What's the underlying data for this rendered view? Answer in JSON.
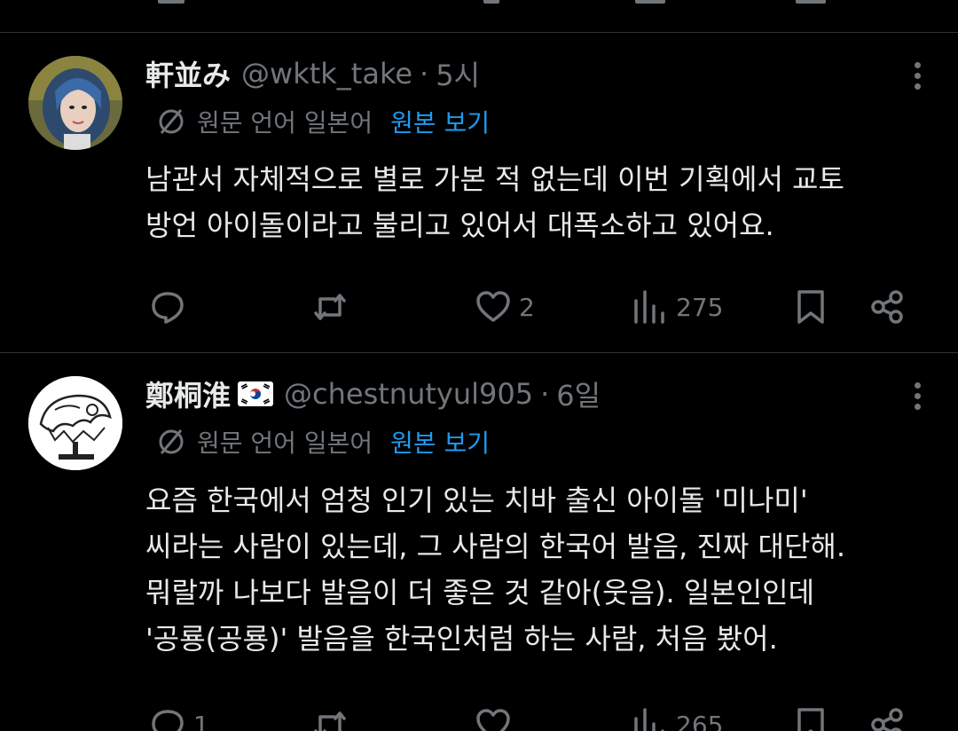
{
  "posts": [
    {
      "display_name": "軒並み",
      "handle": "@wktk_take",
      "separator": "·",
      "time": "5시",
      "has_flag": false,
      "translate": {
        "label": "원문 언어 일본어",
        "link": "원본 보기"
      },
      "lines": [
        "남관서 자체적으로 별로 가본 적 없는데 이번 기획에서 교토",
        "방언 아이돌이라고 불리고 있어서 대폭소하고 있어요."
      ],
      "stats": {
        "replies": "",
        "reposts": "",
        "likes": "2",
        "views": "275"
      }
    },
    {
      "display_name": "鄭桐淮",
      "handle": "@chestnutyul905",
      "separator": "·",
      "time": "6일",
      "has_flag": true,
      "translate": {
        "label": "원문 언어 일본어",
        "link": "원본 보기"
      },
      "lines": [
        "요즘 한국에서 엄청 인기 있는 치바 출신 아이돌 '미나미'",
        "씨라는 사람이 있는데, 그 사람의 한국어 발음, 진짜 대단해.",
        "뭐랄까 나보다 발음이 더 좋은 것 같아(웃음). 일본인인데",
        "'공룡(공룡)' 발음을 한국인처럼 하는 사람, 처음 봤어."
      ],
      "stats": {
        "replies": "1",
        "reposts": "",
        "likes": "",
        "views": "265"
      }
    }
  ],
  "colors": {
    "background": "#000000",
    "text": "#e7e9ea",
    "muted": "#71767b",
    "link": "#1d9bf0",
    "divider": "#2f3336"
  },
  "icons": {
    "reply": "reply-icon",
    "repost": "repost-icon",
    "like": "heart-icon",
    "views": "views-icon",
    "bookmark": "bookmark-icon",
    "share": "share-icon",
    "more": "more-icon",
    "translate": "translate-icon",
    "flag": "south-korea-flag-icon"
  }
}
